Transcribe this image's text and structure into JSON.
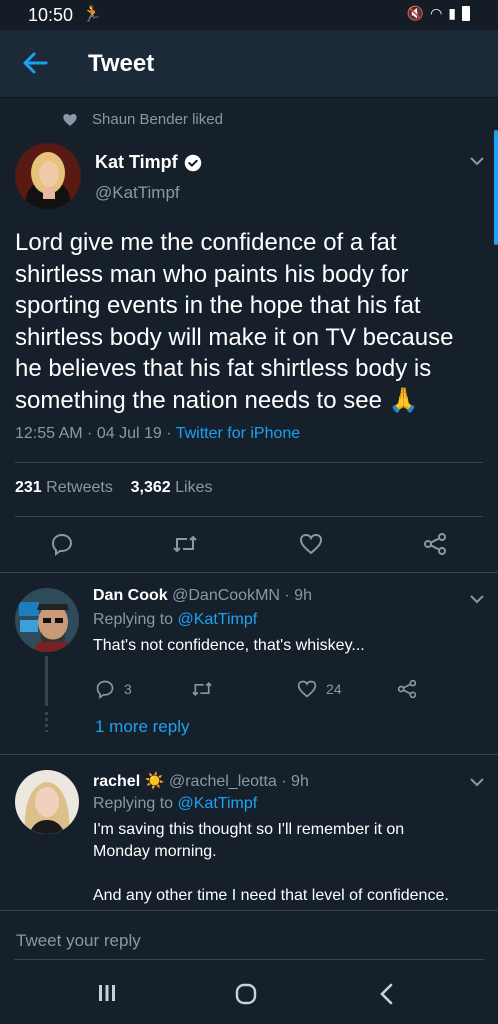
{
  "status": {
    "time": "10:50"
  },
  "appbar": {
    "title": "Tweet"
  },
  "social_context": {
    "text": "Shaun Bender liked"
  },
  "tweet": {
    "name": "Kat Timpf",
    "handle": "@KatTimpf",
    "text": "Lord give me the confidence of a fat\nshirtless man who paints his body for\nsporting events in the hope that his fat\nshirtless body will make it on TV because\nhe believes that his fat shirtless body is\nsomething the nation needs to see 🙏",
    "time": "12:55 AM · 04 Jul 19 · ",
    "client": "Twitter for iPhone",
    "retweets_count": "231",
    "retweets_label": "Retweets",
    "likes_count": "3,362",
    "likes_label": "Likes"
  },
  "replies": [
    {
      "name": "Dan Cook",
      "handle_time": "@DanCookMN · 9h",
      "replying_label": "Replying to ",
      "replying_to": "@KatTimpf",
      "text": "That's not confidence, that's whiskey...",
      "reply_count": "3",
      "like_count": "24",
      "more_replies": "1 more reply"
    },
    {
      "name": "rachel",
      "emoji": "☀️",
      "handle_time": "@rachel_leotta · 9h",
      "replying_label": "Replying to ",
      "replying_to": "@KatTimpf",
      "text": "I'm saving this thought so I'll remember it on\nMonday morning.\n\nAnd any other time I need that level of confidence."
    }
  ],
  "compose": {
    "placeholder": "Tweet your reply"
  },
  "colors": {
    "background": "#15202b",
    "accent": "#1da1f2",
    "secondary_text": "#8899a6",
    "divider": "#38444d"
  }
}
